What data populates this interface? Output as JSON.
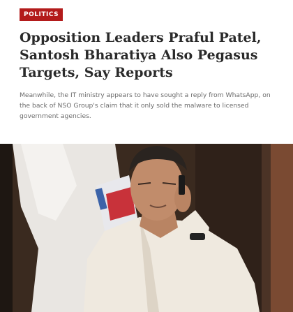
{
  "article": {
    "category": "Politics",
    "headline": "Opposition Leaders Praful Patel, Santosh Bharatiya Also Pegasus Targets, Say Reports",
    "summary": "Meanwhile, the IT ministry appears to have sought a reply from WhatsApp, on the back of NSO Group's claim that it only sold the malware to licensed government agencies."
  },
  "image": {
    "subject": "man-on-phone-photo"
  },
  "colors": {
    "badge": "#b31b1b",
    "headline": "#2a2a2a",
    "summary": "#6b6b6b"
  }
}
